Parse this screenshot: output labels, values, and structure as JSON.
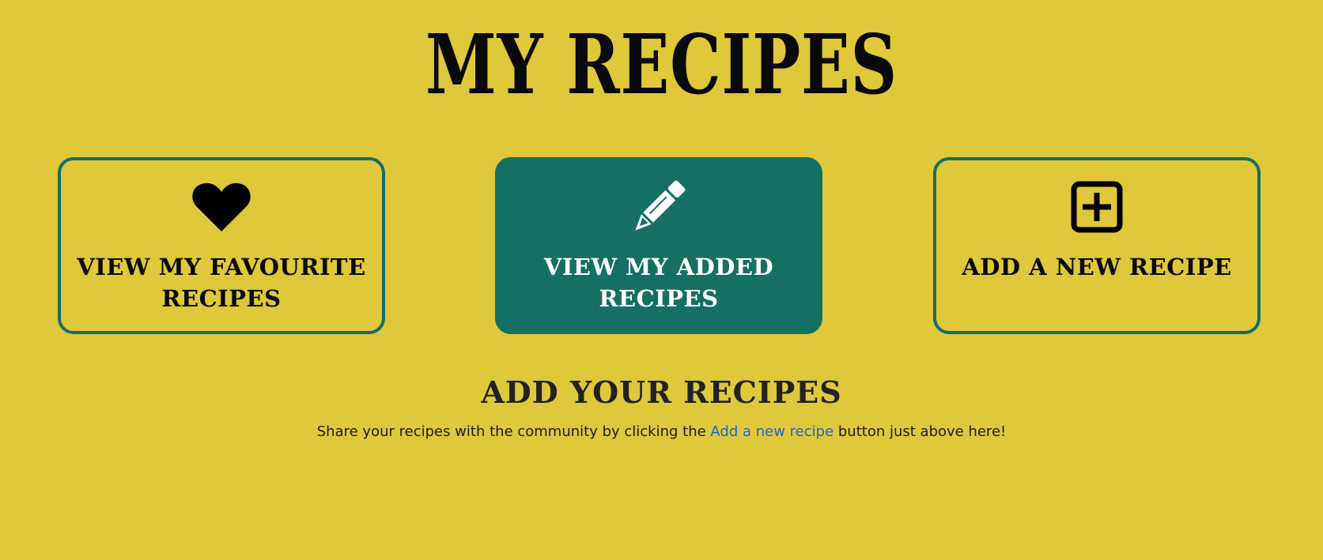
{
  "page": {
    "title": "MY RECIPES",
    "background_color": "#dfc83a",
    "accent_color": "#156f63"
  },
  "cards": [
    {
      "label": "VIEW MY FAVOURITE RECIPES",
      "icon": "heart-icon",
      "active": false
    },
    {
      "label": "VIEW MY ADDED RECIPES",
      "icon": "pencil-icon",
      "active": true
    },
    {
      "label": "ADD A NEW RECIPE",
      "icon": "plus-square-icon",
      "active": false
    }
  ],
  "section": {
    "heading": "ADD YOUR RECIPES",
    "text_before": "Share your recipes with the community by clicking the ",
    "link_text": "Add a new recipe",
    "text_after": " button just above here!",
    "link_color": "#1a63d6"
  }
}
